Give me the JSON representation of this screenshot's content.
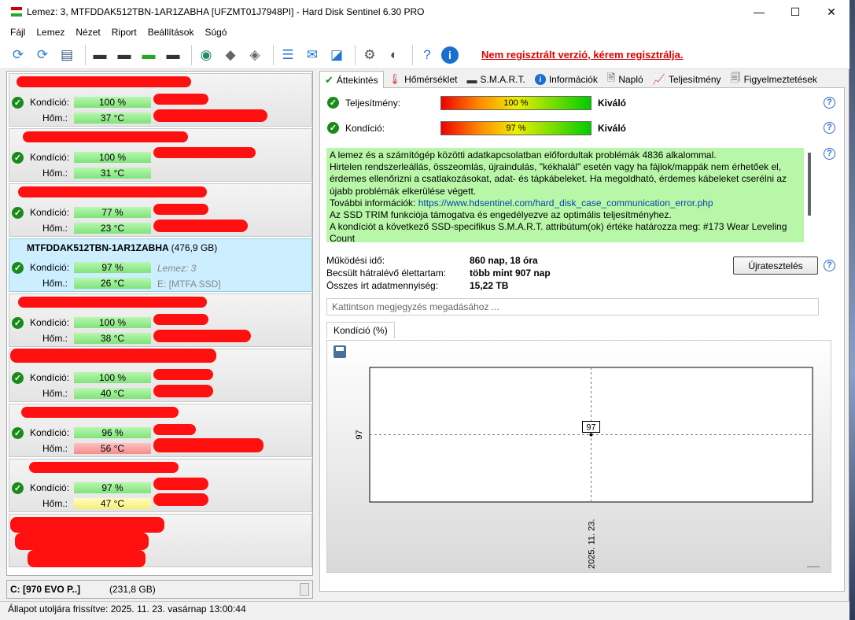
{
  "window": {
    "title": "Lemez: 3, MTFDDAK512TBN-1AR1ZABHA [UFZMT01J7948PI]  -  Hard Disk Sentinel 6.30 PRO",
    "minimize": "—",
    "maximize": "☐",
    "close": "✕"
  },
  "menu": [
    "Fájl",
    "Lemez",
    "Nézet",
    "Riport",
    "Beállítások",
    "Súgó"
  ],
  "toolbar": {
    "unregistered": "Nem regisztrált verzió, kérem regisztrálja."
  },
  "disks": [
    {
      "name": "",
      "size": "",
      "cond_label": "Kondíció:",
      "cond": "100 %",
      "temp_label": "Hőm.:",
      "temp": "37 °C",
      "temp_color": "green",
      "extra1": "",
      "extra2": "",
      "selected": false
    },
    {
      "name": "",
      "size": "",
      "cond_label": "Kondíció:",
      "cond": "100 %",
      "temp_label": "Hőm.:",
      "temp": "31 °C",
      "temp_color": "green",
      "extra1": "",
      "extra2": "",
      "selected": false
    },
    {
      "name": "",
      "size": "",
      "cond_label": "Kondíció:",
      "cond": "77 %",
      "temp_label": "Hőm.:",
      "temp": "23 °C",
      "temp_color": "green",
      "extra1": "",
      "extra2": "",
      "selected": false
    },
    {
      "name": "MTFDDAK512TBN-1AR1ZABHA",
      "size": "(476,9 GB)",
      "cond_label": "Kondíció:",
      "cond": "97 %",
      "temp_label": "Hőm.:",
      "temp": "26 °C",
      "temp_color": "green",
      "extra1": "Lemez: 3",
      "extra2": "E: [MTFA SSD]",
      "selected": true
    },
    {
      "name": "",
      "size": "",
      "cond_label": "Kondíció:",
      "cond": "100 %",
      "temp_label": "Hőm.:",
      "temp": "38 °C",
      "temp_color": "green",
      "extra1": "",
      "extra2": "",
      "selected": false
    },
    {
      "name": "",
      "size": "",
      "cond_label": "Kondíció:",
      "cond": "100 %",
      "temp_label": "Hőm.:",
      "temp": "40 °C",
      "temp_color": "green",
      "extra1": "",
      "extra2": "",
      "selected": false
    },
    {
      "name": "",
      "size": "",
      "cond_label": "Kondíció:",
      "cond": "96 %",
      "temp_label": "Hőm.:",
      "temp": "56 °C",
      "temp_color": "red",
      "extra1": "",
      "extra2": "",
      "selected": false
    },
    {
      "name": "",
      "size": "",
      "cond_label": "Kondíció:",
      "cond": "97 %",
      "temp_label": "Hőm.:",
      "temp": "47 °C",
      "temp_color": "yellow",
      "extra1": "",
      "extra2": "",
      "selected": false
    }
  ],
  "left_footer": {
    "drive": "C: [970 EVO P..]",
    "size": "(231,8 GB)"
  },
  "statusbar": "Állapot utoljára frissítve: 2025. 11. 23. vasárnap 13:00:44",
  "tabs": [
    "Áttekintés",
    "Hőmérséklet",
    "S.M.A.R.T.",
    "Információk",
    "Napló",
    "Teljesítmény",
    "Figyelmeztetések"
  ],
  "overview": {
    "perf_label": "Teljesítmény:",
    "perf_value": "100 %",
    "perf_rating": "Kiváló",
    "cond_label": "Kondíció:",
    "cond_value": "97 %",
    "cond_rating": "Kiváló",
    "msg_lines": [
      "A lemez és a számítógép közötti adatkapcsolatban előfordultak problémák 4836 alkalommal.",
      "Hirtelen rendszerleállás, összeomlás, újraindulás, \"kékhalál\" esetén vagy ha fájlok/mappák nem érhetőek el, érdemes ellenőrizni a csatlakozásokat, adat- és tápkábeleket. Ha megoldható, érdemes kábeleket cserélni az újabb problémák elkerülése végett."
    ],
    "msg_more": "További információk: ",
    "msg_link": "https://www.hdsentinel.com/hard_disk_case_communication_error.php",
    "msg_trim": "Az SSD TRIM funkciója támogatva és engedélyezve az optimális teljesítményhez.",
    "msg_smart": "A kondíciót a következő SSD-specifikus S.M.A.R.T. attribútum(ok) értéke határozza meg:  #173 Wear Leveling Count",
    "uptime_label": "Működési idő:",
    "uptime": "860 nap, 18 óra",
    "life_label": "Becsült hátralévő élettartam:",
    "life": "több mint 907 nap",
    "written_label": "Összes írt adatmennyiség:",
    "written": "15,22 TB",
    "retest": "Újratesztelés",
    "note_placeholder": "Kattintson megjegyzés megadásához ...",
    "chart_tab": "Kondíció  (%)"
  },
  "chart_data": {
    "type": "scatter",
    "x": [
      "2025. 11. 23."
    ],
    "values": [
      97
    ],
    "point_labels": [
      "97"
    ],
    "yticks": [
      "97"
    ],
    "grid": "dashed crosshair at point"
  }
}
